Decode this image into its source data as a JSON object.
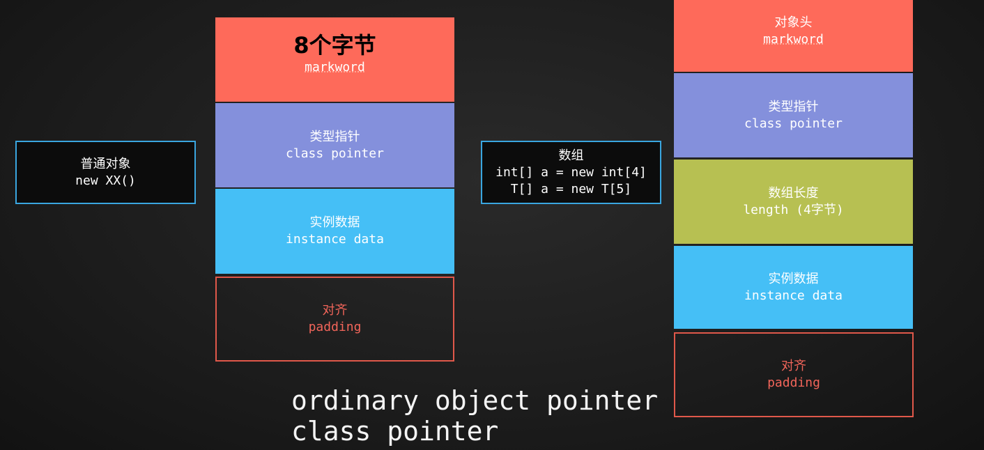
{
  "ordinary_object": {
    "source": {
      "title": "普通对象",
      "code": "new XX()"
    },
    "layout": [
      {
        "zh": "8个字节",
        "en": "markword"
      },
      {
        "zh": "类型指针",
        "en": "class pointer"
      },
      {
        "zh": "实例数据",
        "en": "instance data"
      },
      {
        "zh": "对齐",
        "en": "padding"
      }
    ]
  },
  "array_object": {
    "source": {
      "title": "数组",
      "code1": "int[] a = new int[4]",
      "code2": "T[] a = new T[5]"
    },
    "layout": [
      {
        "zh": "对象头",
        "en": "markword"
      },
      {
        "zh": "类型指针",
        "en": "class pointer"
      },
      {
        "zh": "数组长度",
        "en": "length (4字节)"
      },
      {
        "zh": "实例数据",
        "en": "instance data"
      },
      {
        "zh": "对齐",
        "en": "padding"
      }
    ]
  },
  "caption": {
    "line1": "ordinary object pointer",
    "line2": "class pointer"
  },
  "colors": {
    "markword": "#fe6a5a",
    "class_pointer": "#8490dc",
    "instance_data": "#45bff6",
    "length": "#b7c052",
    "padding_border": "#e0584a",
    "source_border": "#3aa6e0"
  }
}
